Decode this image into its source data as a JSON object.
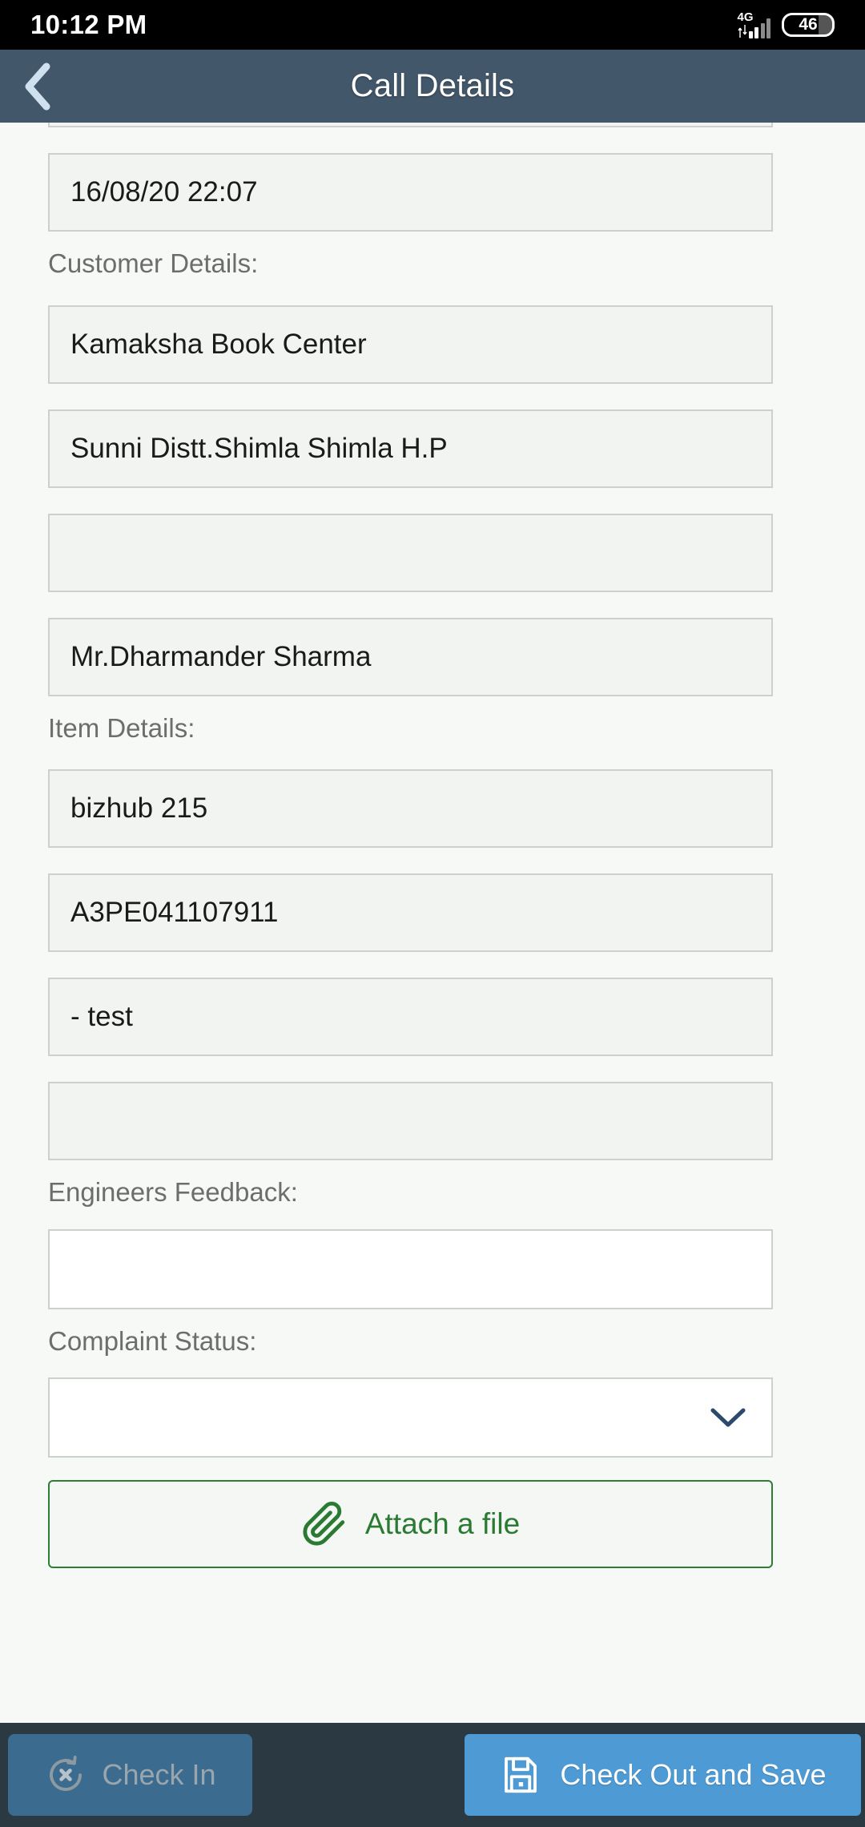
{
  "status_bar": {
    "time": "10:12 PM",
    "network_type": "4G",
    "battery_level": "46",
    "signal_bars_filled": 2,
    "signal_bars_total": 4
  },
  "app_bar": {
    "title": "Call Details",
    "back_icon": "chevron-left-icon"
  },
  "colors": {
    "app_bar": "#42576a",
    "page_background": "#f7f9f7",
    "field_fill": "#f2f4f2",
    "field_border": "#cdd1cd",
    "accent_green": "#2a7a33",
    "accent_blue": "#4d9ad4",
    "bottom_bar": "#2b3943",
    "disabled_button": "#3b6b8e",
    "chevron": "#2c4a6b"
  },
  "form": {
    "clipped_top_field": {
      "value": ""
    },
    "datetime_field": {
      "value": "16/08/20 22:07"
    },
    "customer_section": {
      "label": "Customer Details:",
      "fields": [
        {
          "name": "customer-name",
          "value": "Kamaksha Book Center"
        },
        {
          "name": "customer-address",
          "value": "Sunni Distt.Shimla  Shimla H.P"
        },
        {
          "name": "customer-phone",
          "value": ""
        },
        {
          "name": "customer-contact-person",
          "value": "Mr.Dharmander Sharma"
        }
      ]
    },
    "item_section": {
      "label": "Item Details:",
      "fields": [
        {
          "name": "item-model",
          "value": "bizhub 215"
        },
        {
          "name": "item-serial",
          "value": "A3PE041107911"
        },
        {
          "name": "item-problem",
          "value": "- test"
        },
        {
          "name": "item-extra",
          "value": ""
        }
      ]
    },
    "engineers_feedback": {
      "label": "Engineers Feedback:",
      "value": "",
      "placeholder": ""
    },
    "complaint_status": {
      "label": "Complaint Status:",
      "value": "",
      "chevron_icon": "chevron-down-icon"
    },
    "attach": {
      "label": "Attach a file",
      "icon": "paperclip-icon"
    }
  },
  "bottom_bar": {
    "check_in": {
      "label": "Check In",
      "icon": "rotate-cancel-icon",
      "enabled": false
    },
    "check_out": {
      "label": "Check Out and Save",
      "icon": "save-floppy-icon",
      "enabled": true
    }
  }
}
